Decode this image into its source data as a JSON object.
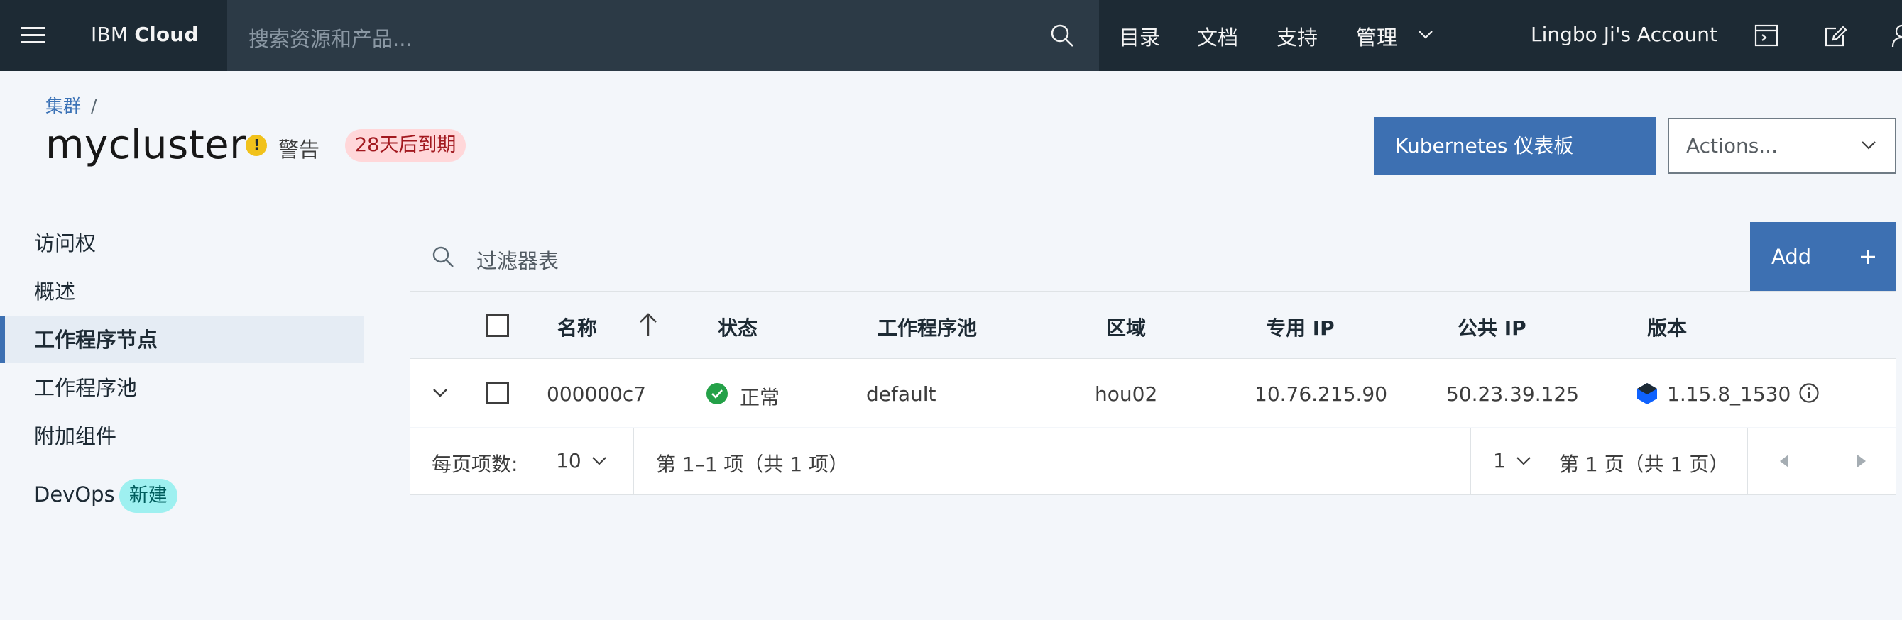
{
  "header": {
    "brand_regular": "IBM ",
    "brand_bold": "Cloud",
    "search_placeholder": "搜索资源和产品...",
    "nav": [
      "目录",
      "文档",
      "支持",
      "管理"
    ],
    "account": "Lingbo Ji's Account"
  },
  "breadcrumb": {
    "item": "集群",
    "separator": "/"
  },
  "cluster": {
    "name": "mycluster",
    "status": "警告",
    "expiry_tag": "28天后到期"
  },
  "buttons": {
    "dashboard": "Kubernetes 仪表板",
    "actions": "Actions...",
    "add": "Add"
  },
  "sidenav": {
    "items": [
      "访问权",
      "概述",
      "工作程序节点",
      "工作程序池",
      "附加组件"
    ],
    "devops_label": "DevOps",
    "devops_tag": "新建"
  },
  "filter": {
    "placeholder": "过滤器表"
  },
  "table": {
    "headers": [
      "名称",
      "状态",
      "工作程序池",
      "区域",
      "专用 IP",
      "公共 IP",
      "版本"
    ],
    "rows": [
      {
        "name": "000000c7",
        "status": "正常",
        "pool": "default",
        "zone": "hou02",
        "private_ip": "10.76.215.90",
        "public_ip": "50.23.39.125",
        "version": "1.15.8_1530"
      }
    ]
  },
  "pagination": {
    "per_page_label": "每页项数:",
    "per_page_value": "10",
    "range_text": "第 1–1 项（共 1 项）",
    "page_value": "1",
    "page_text": "第 1 页（共 1 页）"
  },
  "colors": {
    "header_bg": "#1d2a34",
    "primary": "#3d70b2",
    "warning": "#f1c21b",
    "success": "#24a148",
    "expiry_bg": "#ffd7d9",
    "devops_tag_bg": "#9ef0f0"
  }
}
